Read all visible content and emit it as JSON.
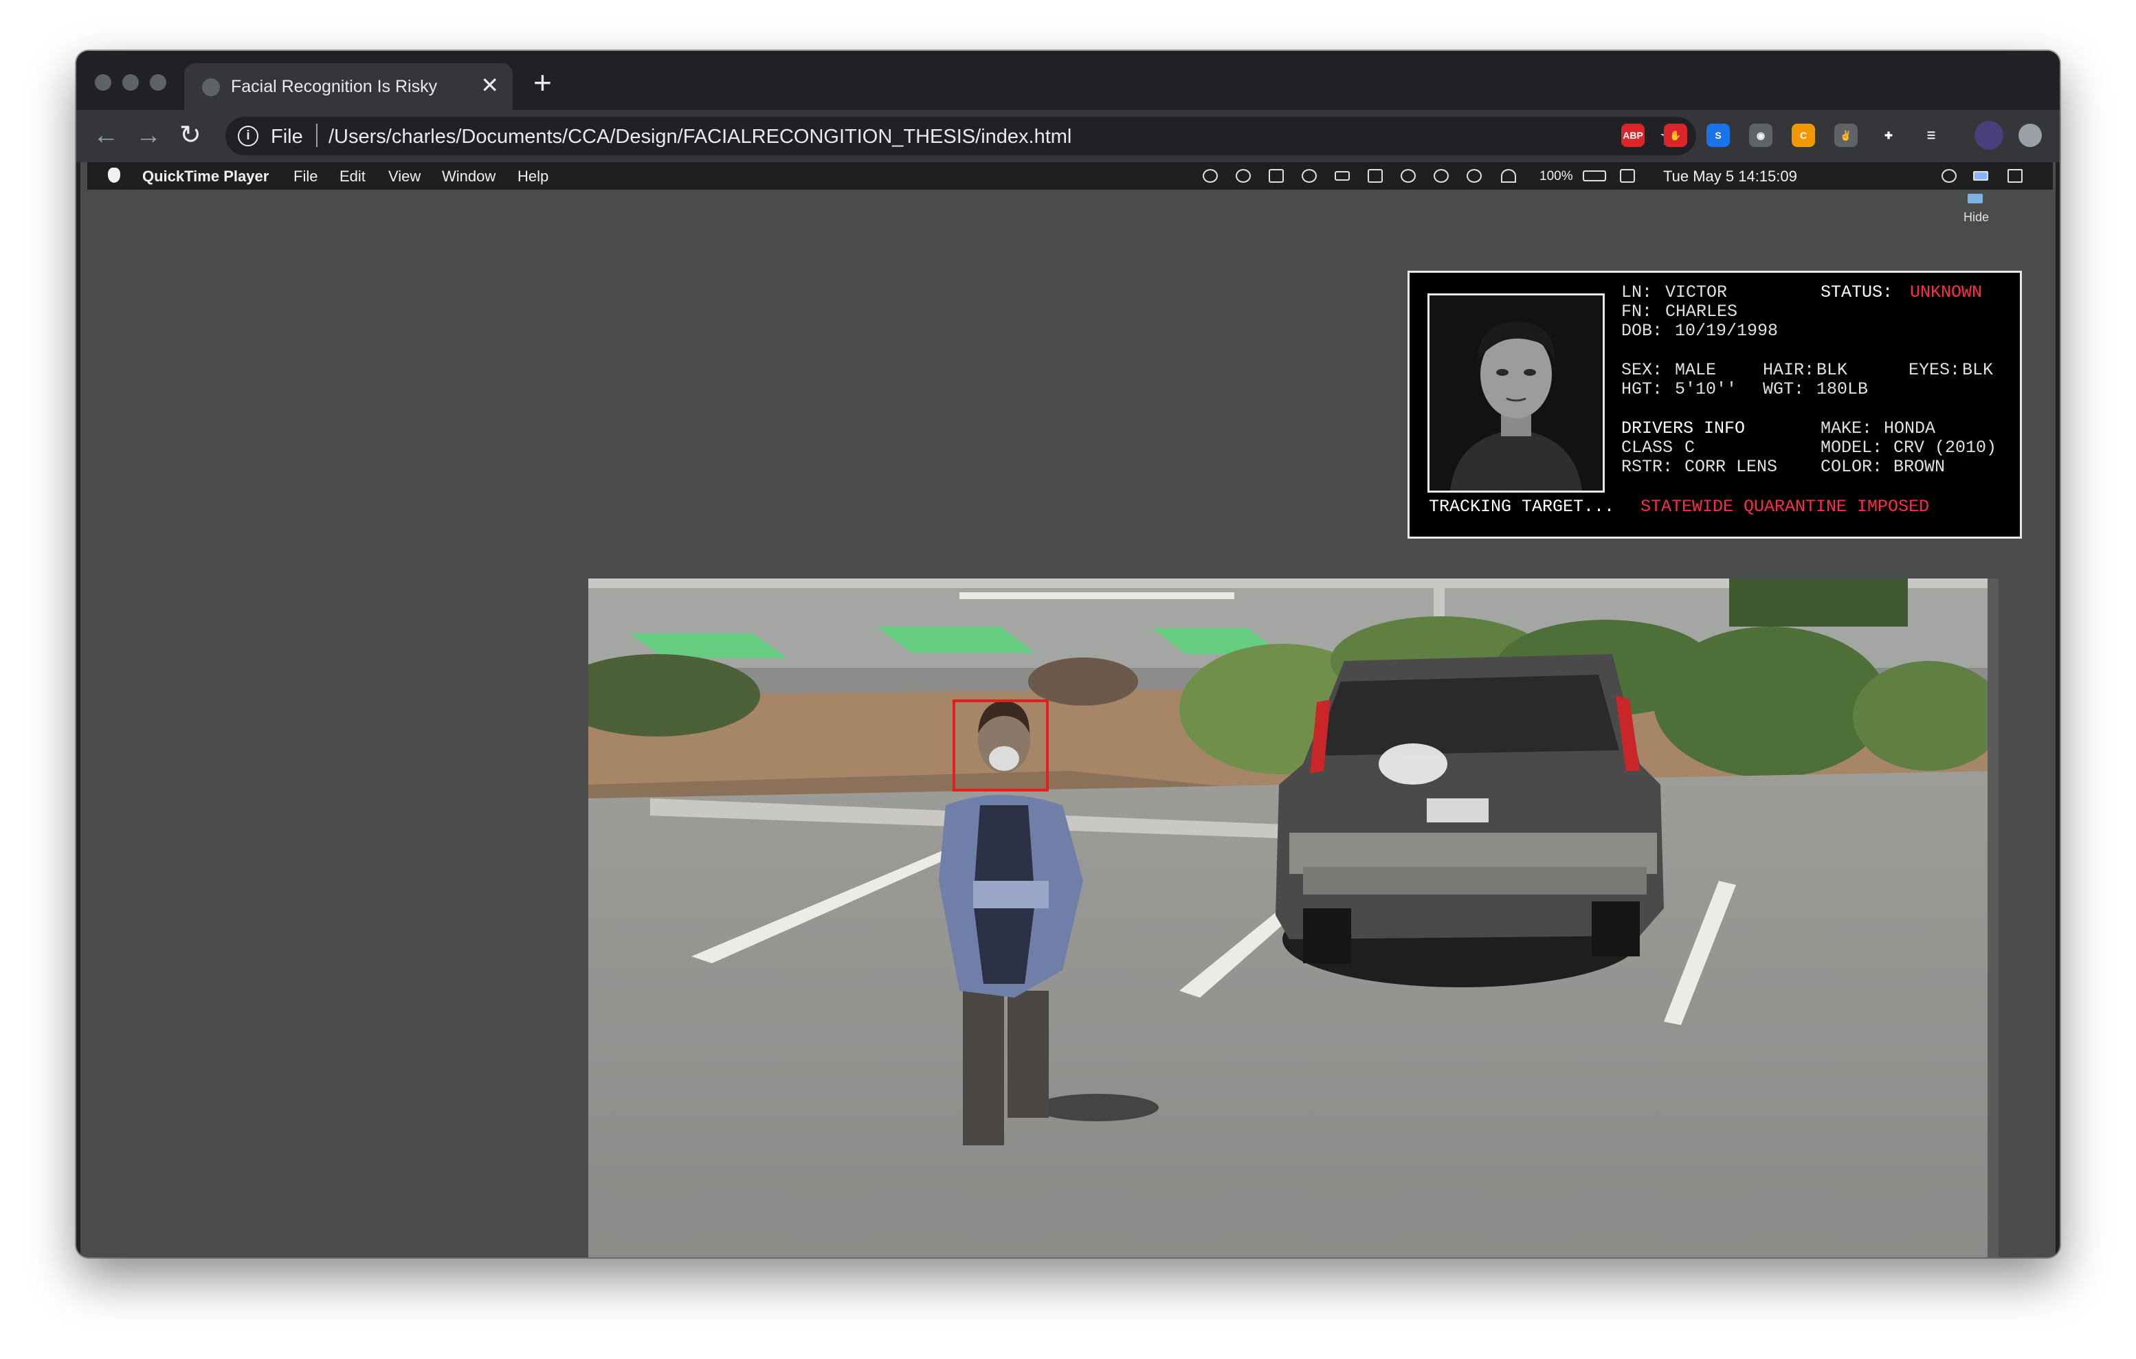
{
  "browser": {
    "tab": {
      "title": "Facial Recognition Is Risky",
      "close": "✕"
    },
    "new_tab": "+",
    "nav": {
      "back": "←",
      "forward": "→",
      "reload": "↻"
    },
    "omnibox": {
      "scheme": "File",
      "url": "/Users/charles/Documents/CCA/Design/FACIALRECONGITION_THESIS/index.html",
      "star": "☆"
    },
    "extensions": [
      {
        "name": "adblock-plus-icon",
        "text": "ABP",
        "color": "#d9262b"
      },
      {
        "name": "stop-hand-icon",
        "text": "✋",
        "color": "#d9262b"
      },
      {
        "name": "s-extension-icon",
        "text": "S",
        "color": "#1a73e8"
      },
      {
        "name": "eye-extension-icon",
        "text": "◉",
        "color": "#5f6368"
      },
      {
        "name": "coupon-extension-icon",
        "text": "C",
        "color": "#f29900"
      },
      {
        "name": "hand-extension-icon",
        "text": "✌",
        "color": "#5f6368"
      },
      {
        "name": "puzzle-extensions-icon",
        "text": "✚",
        "color": "#35363a"
      },
      {
        "name": "reading-list-icon",
        "text": "☰",
        "color": "#35363a"
      }
    ]
  },
  "menubar": {
    "app": "QuickTime Player",
    "items": [
      "File",
      "Edit",
      "View",
      "Window",
      "Help"
    ],
    "battery": "100%",
    "datetime": "Tue May 5  14:15:09",
    "hide_label": "Hide"
  },
  "dossier": {
    "ln_label": "LN:",
    "ln_value": "VICTOR",
    "status_label": "STATUS:",
    "status_value": "UNKNOWN",
    "fn_label": "FN:",
    "fn_value": "CHARLES",
    "dob_label": "DOB:",
    "dob_value": "10/19/1998",
    "sex_label": "SEX:",
    "sex_value": "MALE",
    "hair_label": "HAIR:",
    "hair_value": "BLK",
    "eyes_label": "EYES:",
    "eyes_value": "BLK",
    "hgt_label": "HGT:",
    "hgt_value": "5'10''",
    "wgt_label": "WGT:",
    "wgt_value": "180LB",
    "drivers_info": "DRIVERS INFO",
    "class_label": "CLASS",
    "class_value": "C",
    "rstr_label": "RSTR:",
    "rstr_value": "CORR LENS",
    "make_label": "MAKE:",
    "make_value": "HONDA",
    "model_label": "MODEL:",
    "model_value": "CRV (2010)",
    "color_label": "COLOR:",
    "color_value": "BROWN",
    "tracking": "TRACKING TARGET...",
    "alert": "STATEWIDE QUARANTINE IMPOSED"
  },
  "colors": {
    "alert_red": "#ff2a4a",
    "tracking_box": "#e0201c",
    "page_bg": "#4a4b4b"
  }
}
